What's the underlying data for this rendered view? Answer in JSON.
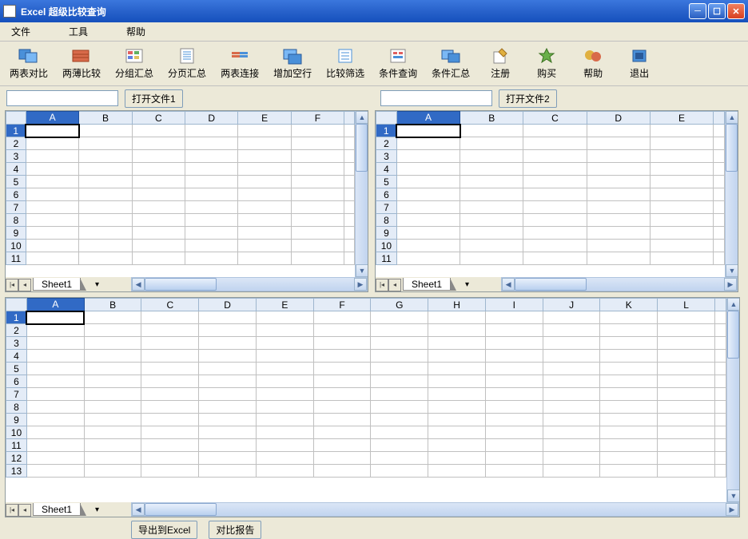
{
  "window": {
    "title": "Excel 超级比较查询"
  },
  "menu": {
    "file": "文件",
    "tools": "工具",
    "help": "帮助"
  },
  "toolbar": {
    "compare_sheets": "两表对比",
    "compare_books": "两薄比较",
    "group_summary": "分组汇总",
    "page_summary": "分页汇总",
    "join_sheets": "两表连接",
    "add_blank_rows": "增加空行",
    "filter_compare": "比较筛选",
    "condition_query": "条件查询",
    "condition_summary": "条件汇总",
    "register": "注册",
    "buy": "购买",
    "help": "帮助",
    "exit": "退出"
  },
  "file_open": {
    "open1": "打开文件1",
    "open2": "打开文件2",
    "path1": "",
    "path2": ""
  },
  "sheet": {
    "cols_small": [
      "A",
      "B",
      "C",
      "D",
      "E",
      "F"
    ],
    "cols_large": [
      "A",
      "B",
      "C",
      "D",
      "E",
      "F",
      "G",
      "H",
      "I",
      "J",
      "K",
      "L"
    ],
    "rows_small": [
      "1",
      "2",
      "3",
      "4",
      "5",
      "6",
      "7",
      "8",
      "9",
      "10",
      "11"
    ],
    "rows_large": [
      "1",
      "2",
      "3",
      "4",
      "5",
      "6",
      "7",
      "8",
      "9",
      "10",
      "11",
      "12",
      "13"
    ],
    "tab_name": "Sheet1"
  },
  "actions": {
    "export_excel": "导出到Excel",
    "compare_report": "对比报告"
  }
}
